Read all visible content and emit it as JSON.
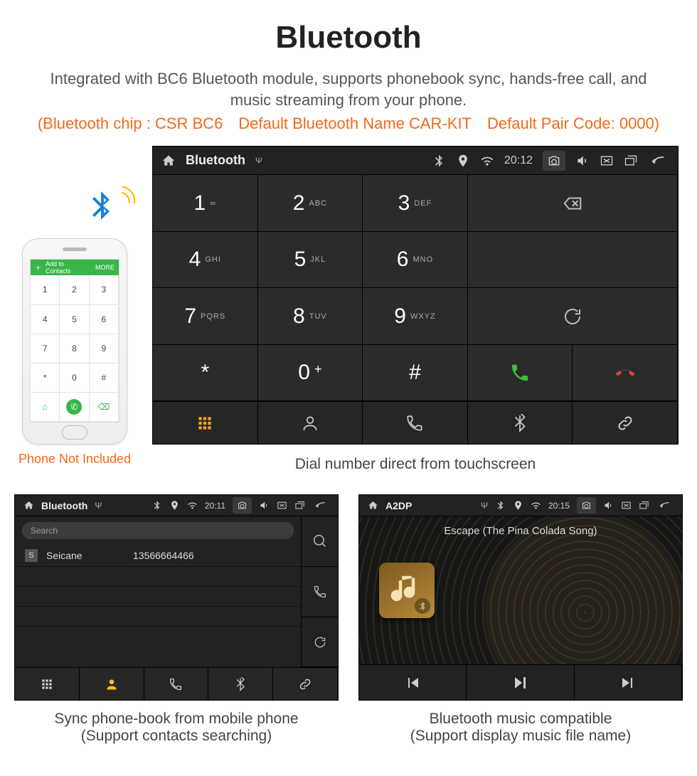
{
  "page": {
    "title": "Bluetooth",
    "subtitle": "Integrated with BC6 Bluetooth module, supports phonebook sync, hands-free call, and music streaming from your phone.",
    "subline": "(Bluetooth chip : CSR BC6 Default Bluetooth Name CAR-KIT Default Pair Code: 0000)"
  },
  "phone": {
    "caption": "Phone Not Included",
    "topbar_label": "Add to Contacts",
    "topbar_more": "MORE",
    "keys": [
      "1",
      "2",
      "3",
      "4",
      "5",
      "6",
      "7",
      "8",
      "9",
      "*",
      "0",
      "#"
    ]
  },
  "dialer": {
    "statusbar": {
      "title": "Bluetooth",
      "time": "20:12"
    },
    "keys": [
      {
        "num": "1",
        "let": "∞"
      },
      {
        "num": "2",
        "let": "ABC"
      },
      {
        "num": "3",
        "let": "DEF"
      },
      {
        "num": "4",
        "let": "GHI"
      },
      {
        "num": "5",
        "let": "JKL"
      },
      {
        "num": "6",
        "let": "MNO"
      },
      {
        "num": "7",
        "let": "PQRS"
      },
      {
        "num": "8",
        "let": "TUV"
      },
      {
        "num": "9",
        "let": "WXYZ"
      },
      {
        "num": "*",
        "let": ""
      },
      {
        "num": "0",
        "let": "+",
        "plus": true
      },
      {
        "num": "#",
        "let": ""
      }
    ],
    "caption": "Dial number direct from touchscreen"
  },
  "phonebook": {
    "statusbar": {
      "title": "Bluetooth",
      "time": "20:11"
    },
    "search_placeholder": "Search",
    "contact": {
      "badge": "S",
      "name": "Seicane",
      "number": "13566664466"
    },
    "caption_line1": "Sync phone-book from mobile phone",
    "caption_line2": "(Support contacts searching)"
  },
  "a2dp": {
    "statusbar": {
      "title": "A2DP",
      "time": "20:15"
    },
    "track": "Escape (The Pina Colada Song)",
    "caption_line1": "Bluetooth music compatible",
    "caption_line2": "(Support display music file name)"
  }
}
